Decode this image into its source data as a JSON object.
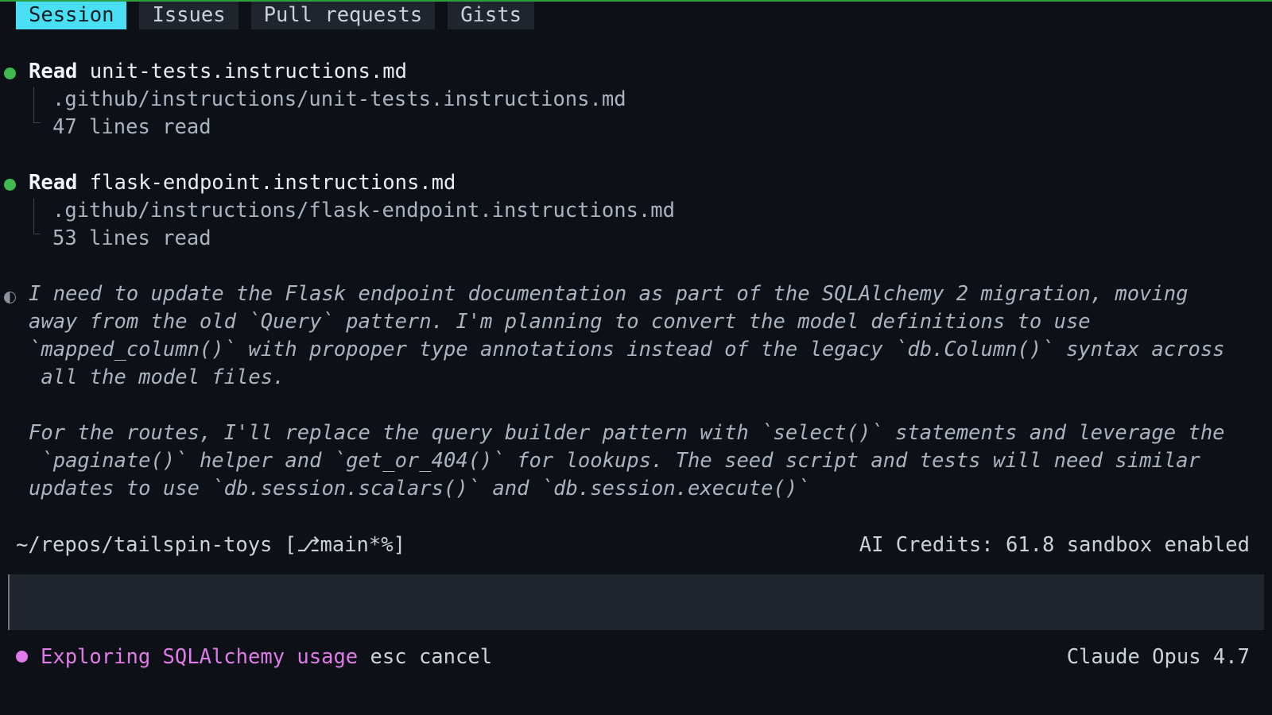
{
  "tabs": [
    {
      "label": "Session",
      "active": true
    },
    {
      "label": "Issues",
      "active": false
    },
    {
      "label": "Pull requests",
      "active": false
    },
    {
      "label": "Gists",
      "active": false
    }
  ],
  "entries": [
    {
      "verb": "Read",
      "file": "unit-tests.instructions.md",
      "path": ".github/instructions/unit-tests.instructions.md",
      "result": "47 lines read"
    },
    {
      "verb": "Read",
      "file": "flask-endpoint.instructions.md",
      "path": ".github/instructions/flask-endpoint.instructions.md",
      "result": "53 lines read"
    }
  ],
  "thinking": {
    "paragraph1": "I need to update the Flask endpoint documentation as part of the SQLAlchemy 2 migration, moving\naway from the old `Query` pattern. I'm planning to convert the model definitions to use\n`mapped_column()` with propoper type annotations instead of the legacy `db.Column()` syntax across\n all the model files.",
    "paragraph2": "For the routes, I'll replace the query builder pattern with `select()` statements and leverage the\n `paginate()` helper and `get_or_404()` for lookups. The seed script and tests will need similar\nupdates to use `db.session.scalars()` and `db.session.execute()`"
  },
  "status": {
    "cwd": "~/repos/tailspin-toys [⎇main*%]",
    "right": "AI Credits: 61.8 sandbox enabled"
  },
  "input": {
    "value": "",
    "placeholder": ""
  },
  "bottom": {
    "activity": "Exploring SQLAlchemy usage",
    "hint": "esc cancel",
    "model": "Claude Opus 4.7"
  },
  "colors": {
    "accent_tab": "#4ae0f4",
    "success_dot": "#3fb950",
    "activity": "#e07ae8",
    "background": "#0d1117"
  }
}
